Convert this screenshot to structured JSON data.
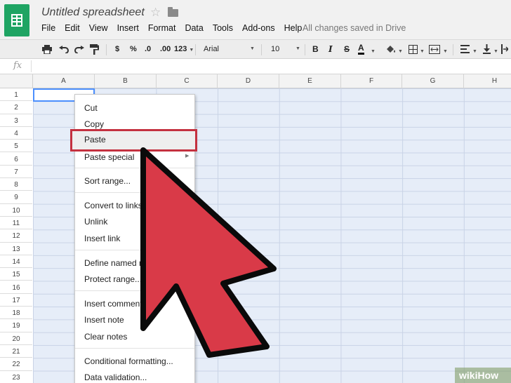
{
  "document": {
    "title": "Untitled spreadsheet",
    "save_status": "All changes saved in Drive"
  },
  "menus": [
    "File",
    "Edit",
    "View",
    "Insert",
    "Format",
    "Data",
    "Tools",
    "Add-ons",
    "Help"
  ],
  "toolbar": {
    "currency": "$",
    "percent": "%",
    "decrease_decimal": ".0",
    "increase_decimal": ".00",
    "more_formats": "123",
    "font_name": "Arial",
    "font_size": "10",
    "bold": "B",
    "italic": "I",
    "strikethrough": "S",
    "text_color": "A"
  },
  "formula": {
    "icon_label": "fx",
    "value": ""
  },
  "columns": [
    "A",
    "B",
    "C",
    "D",
    "E",
    "F",
    "G",
    "H"
  ],
  "rows": [
    "1",
    "2",
    "3",
    "4",
    "5",
    "6",
    "7",
    "8",
    "9",
    "10",
    "11",
    "12",
    "13",
    "14",
    "15",
    "16",
    "17",
    "18",
    "19",
    "20",
    "21",
    "22",
    "23"
  ],
  "context_menu": {
    "cut": "Cut",
    "copy": "Copy",
    "paste": "Paste",
    "paste_special": "Paste special",
    "sort_range": "Sort range...",
    "convert_links": "Convert to links",
    "unlink": "Unlink",
    "insert_link": "Insert link",
    "define_named_range": "Define named range...",
    "protect_range": "Protect range...",
    "insert_comment": "Insert comment",
    "insert_note": "Insert note",
    "clear_notes": "Clear notes",
    "conditional_formatting": "Conditional formatting...",
    "data_validation": "Data validation..."
  },
  "colors": {
    "brand_green": "#1fa463",
    "highlight_red": "#c4313f",
    "arrow_red": "#d93a48",
    "grid_fill": "#e6edf8"
  },
  "icons": [
    "sheets-logo-icon",
    "star-icon",
    "folder-icon",
    "print-icon",
    "undo-icon",
    "redo-icon",
    "paint-format-icon",
    "fill-color-icon",
    "borders-icon",
    "merge-cells-icon",
    "align-left-icon",
    "valign-bottom-icon",
    "fx-icon",
    "arrow-pointer-icon"
  ],
  "watermark": {
    "prefix": "wiki",
    "suffix": "How"
  }
}
